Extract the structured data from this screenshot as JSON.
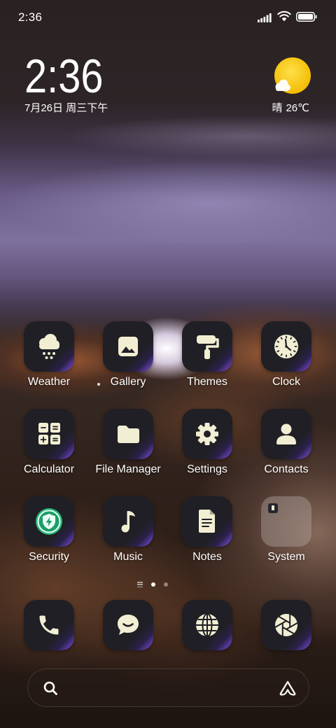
{
  "status_bar": {
    "time": "2:36",
    "signal_icon": "signal-bars-icon",
    "wifi_icon": "wifi-icon",
    "battery_icon": "battery-icon"
  },
  "clock_widget": {
    "time": "2:36",
    "date": "7月26日 周三下午"
  },
  "weather_widget": {
    "icon": "sun-cloud-icon",
    "condition": "晴",
    "temperature": "26℃"
  },
  "apps": [
    {
      "label": "Weather",
      "icon": "weather-snow-cloud-icon"
    },
    {
      "label": "Gallery",
      "icon": "gallery-image-icon"
    },
    {
      "label": "Themes",
      "icon": "paint-roller-icon"
    },
    {
      "label": "Clock",
      "icon": "clock-icon"
    },
    {
      "label": "Calculator",
      "icon": "calculator-icon"
    },
    {
      "label": "File Manager",
      "icon": "folder-icon"
    },
    {
      "label": "Settings",
      "icon": "gear-icon"
    },
    {
      "label": "Contacts",
      "icon": "person-icon"
    },
    {
      "label": "Security",
      "icon": "shield-bolt-icon"
    },
    {
      "label": "Music",
      "icon": "music-note-icon"
    },
    {
      "label": "Notes",
      "icon": "document-icon"
    },
    {
      "label": "System",
      "icon": "app-folder-icon"
    }
  ],
  "page_indicator": {
    "icon": "app-list-icon",
    "pages": 2,
    "current_page": 1
  },
  "dock": [
    {
      "icon": "phone-icon"
    },
    {
      "icon": "message-bubble-icon"
    },
    {
      "icon": "globe-icon"
    },
    {
      "icon": "camera-aperture-icon"
    }
  ],
  "search_bar": {
    "search_icon": "search-icon",
    "assistant_icon": "assistant-logo-icon"
  },
  "colors": {
    "icon_glyph": "#f2eed3",
    "icon_background": "#1f1f25",
    "accent_purple": "#7a4fd6",
    "security_green": "#28b67a",
    "sun_yellow": "#f6c700"
  }
}
